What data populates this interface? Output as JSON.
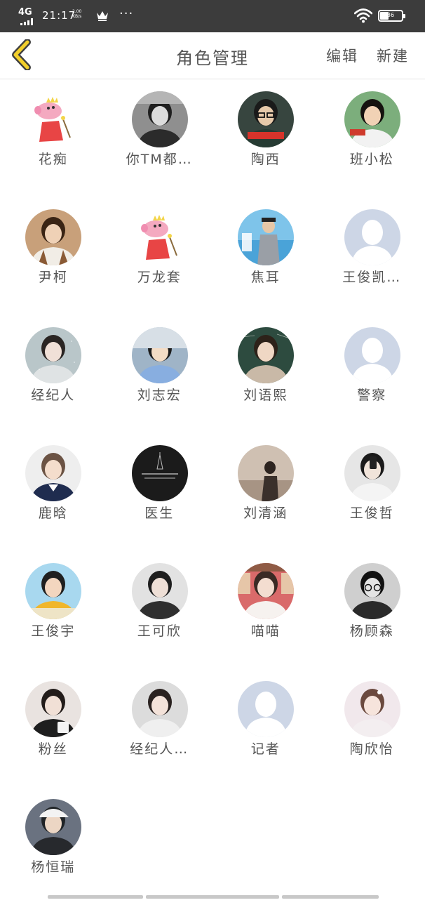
{
  "status_bar": {
    "network": "4G",
    "time": "21:17",
    "speed_value": "2.00",
    "speed_unit": "KB/s",
    "more": "···",
    "battery": "36",
    "icons": [
      "signal-icon",
      "crown-icon",
      "more-icon",
      "wifi-icon",
      "battery-icon"
    ]
  },
  "header": {
    "back_icon": "chevron-left-icon",
    "title": "角色管理",
    "edit_label": "编辑",
    "new_label": "新建",
    "accent_color": "#f2cf2b"
  },
  "roles": [
    {
      "name": "花痴",
      "avatar": "peppa"
    },
    {
      "name": "你TM都…",
      "avatar": "girl-bw"
    },
    {
      "name": "陶西",
      "avatar": "boy-glasses"
    },
    {
      "name": "班小松",
      "avatar": "boy-tv"
    },
    {
      "name": "尹柯",
      "avatar": "boy-warm"
    },
    {
      "name": "万龙套",
      "avatar": "peppa"
    },
    {
      "name": "焦耳",
      "avatar": "blue-poster"
    },
    {
      "name": "王俊凯…",
      "avatar": "default"
    },
    {
      "name": "经纪人",
      "avatar": "girl-grain"
    },
    {
      "name": "刘志宏",
      "avatar": "boy-window"
    },
    {
      "name": "刘语熙",
      "avatar": "girl-board"
    },
    {
      "name": "警察",
      "avatar": "default"
    },
    {
      "name": "鹿晗",
      "avatar": "boy-bright"
    },
    {
      "name": "医生",
      "avatar": "black-tower"
    },
    {
      "name": "刘清涵",
      "avatar": "girl-silhouette"
    },
    {
      "name": "王俊哲",
      "avatar": "boy-phone"
    },
    {
      "name": "王俊宇",
      "avatar": "boy-yellow"
    },
    {
      "name": "王可欣",
      "avatar": "girl-dark"
    },
    {
      "name": "喵喵",
      "avatar": "girl-library"
    },
    {
      "name": "杨顾森",
      "avatar": "boy-glasses-bw"
    },
    {
      "name": "粉丝",
      "avatar": "girl-bag"
    },
    {
      "name": "经纪人…",
      "avatar": "girl-pale"
    },
    {
      "name": "记者",
      "avatar": "default"
    },
    {
      "name": "陶欣怡",
      "avatar": "girl-pink"
    },
    {
      "name": "杨恒瑞",
      "avatar": "boy-cap"
    }
  ]
}
